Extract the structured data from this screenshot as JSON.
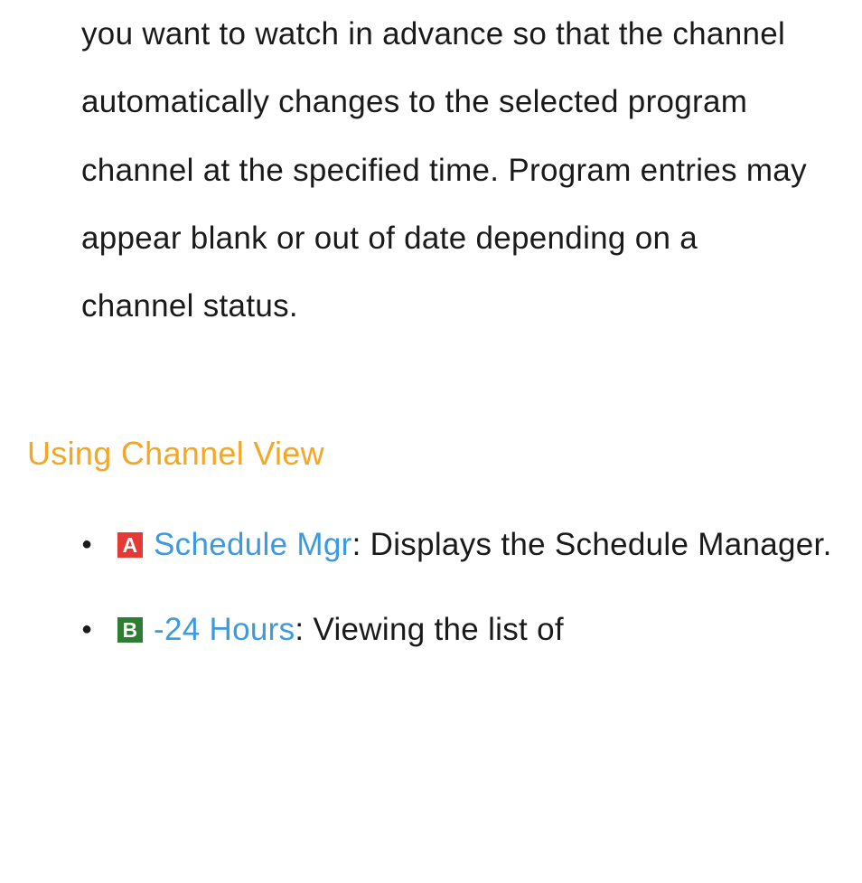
{
  "intro_paragraph": "you want to watch in advance so that the channel automatically changes to the selected program channel at the specified time. Program entries may appear blank or out of date depending on a channel status.",
  "section_heading": "Using Channel View",
  "items": [
    {
      "badge": "A",
      "label": "Schedule Mgr",
      "description": ": Displays the Schedule Manager."
    },
    {
      "badge": "B",
      "label": "-24 Hours",
      "description": ": Viewing the list of"
    }
  ]
}
